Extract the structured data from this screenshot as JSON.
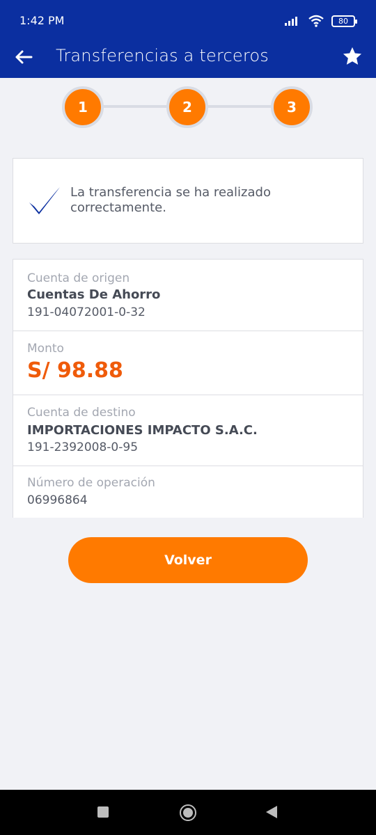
{
  "status_bar": {
    "time": "1:42 PM",
    "battery": "80"
  },
  "app_bar": {
    "title": "Transferencias a terceros"
  },
  "stepper": {
    "steps": [
      "1",
      "2",
      "3"
    ]
  },
  "success": {
    "message": "La transferencia se ha realizado correctamente."
  },
  "details": {
    "origin_label": "Cuenta de origen",
    "origin_name": "Cuentas De Ahorro",
    "origin_number": "191-04072001-0-32",
    "amount_label": "Monto",
    "amount_value": "S/ 98.88",
    "dest_label": "Cuenta de destino",
    "dest_name": "IMPORTACIONES IMPACTO S.A.C.",
    "dest_number": "191-2392008-0-95",
    "op_label": "Número de operación",
    "op_number": "06996864"
  },
  "actions": {
    "back_label": "Volver"
  },
  "colors": {
    "brand_blue": "#0b2fa0",
    "accent_orange": "#ff7a00",
    "amount_orange": "#ef5b0a"
  }
}
